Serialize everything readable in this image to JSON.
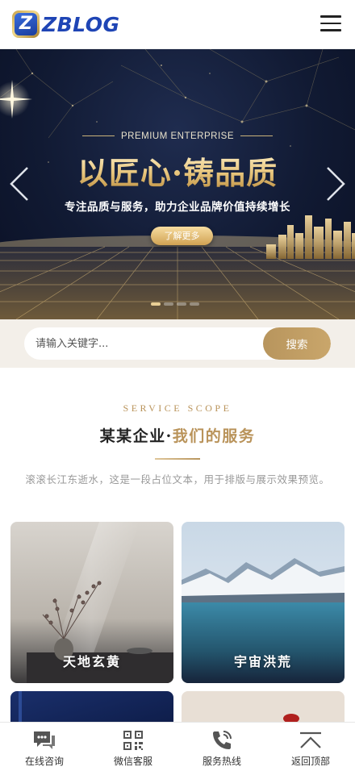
{
  "header": {
    "logo_letter": "Z",
    "logo_text": "ZBLOG"
  },
  "banner": {
    "subtitle": "PREMIUM ENTERPRISE",
    "title": "以匠心·铸品质",
    "description": "专注品质与服务，助力企业品牌价值持续增长",
    "button_label": "了解更多",
    "slide_count": 4,
    "active_slide": 1
  },
  "search": {
    "placeholder": "请输入关键字...",
    "button_label": "搜索"
  },
  "services": {
    "eyebrow": "SERVICE SCOPE",
    "title_prefix": "某某企业·",
    "title_accent": "我们的服务",
    "description": "滚滚长江东逝水，这是一段占位文本，用于排版与展示效果预览。",
    "cards": [
      {
        "label": "天地玄黄"
      },
      {
        "label": "宇宙洪荒"
      },
      {
        "label": ""
      },
      {
        "label": ""
      }
    ]
  },
  "bottom_nav": [
    {
      "label": "在线咨询",
      "icon": "chat-icon"
    },
    {
      "label": "微信客服",
      "icon": "qrcode-icon"
    },
    {
      "label": "服务热线",
      "icon": "phone-icon"
    },
    {
      "label": "返回顶部",
      "icon": "back-to-top-icon"
    }
  ],
  "colors": {
    "brand_blue": "#1f45b5",
    "gold": "#b9935a",
    "search_bg": "#f3efe9"
  }
}
